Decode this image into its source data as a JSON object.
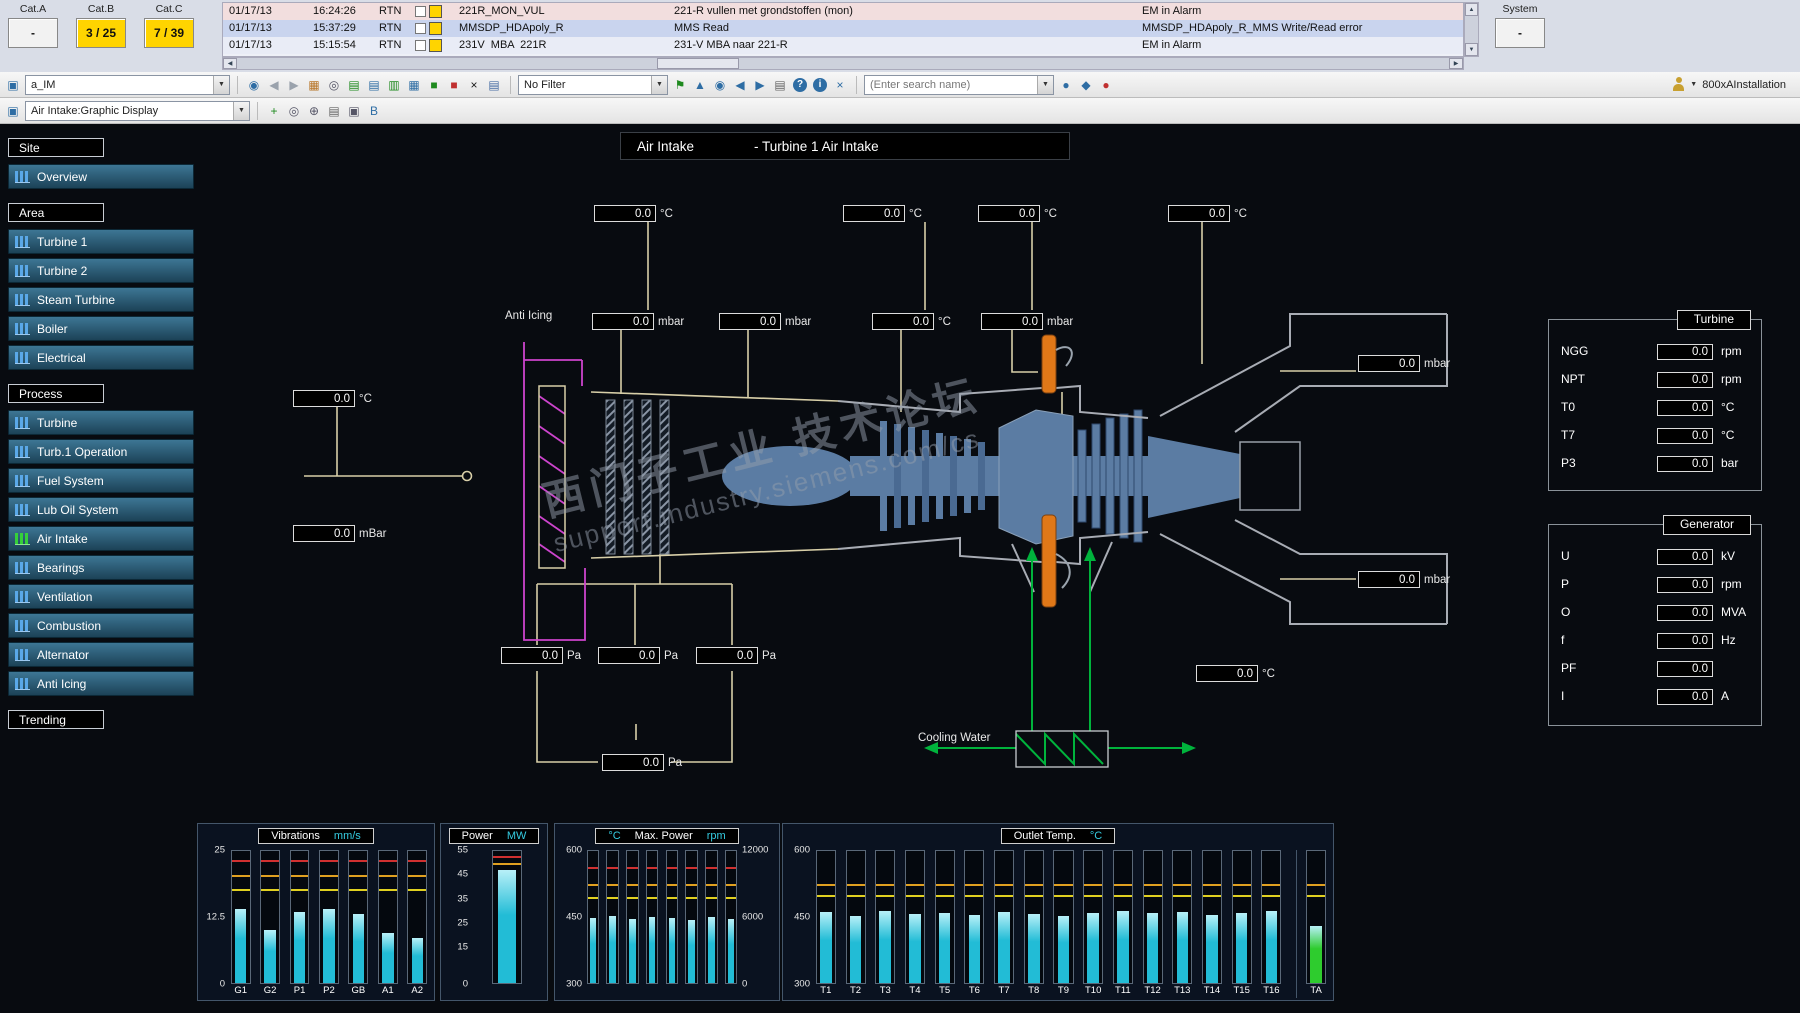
{
  "alarm_bar": {
    "categories": [
      {
        "label": "Cat.A",
        "value": "-",
        "alarm": false
      },
      {
        "label": "Cat.B",
        "value": "3 / 25",
        "alarm": true
      },
      {
        "label": "Cat.C",
        "value": "7 / 39",
        "alarm": true
      }
    ],
    "rows": [
      {
        "date": "01/17/13",
        "time": "16:24:26",
        "type": "RTN",
        "tag": "221R_MON_VUL",
        "description": "221-R vullen met grondstoffen (mon)",
        "status": "EM in Alarm"
      },
      {
        "date": "01/17/13",
        "time": "15:37:29",
        "type": "RTN",
        "tag": "MMSDP_HDApoly_R",
        "description": "MMS Read",
        "status": "MMSDP_HDApoly_R_MMS Write/Read error"
      },
      {
        "date": "01/17/13",
        "time": "15:15:54",
        "type": "RTN",
        "tag": "231V  MBA  221R",
        "description": "231-V MBA naar 221-R",
        "status": "EM in Alarm"
      }
    ],
    "system": {
      "label": "System",
      "value": "-"
    }
  },
  "toolbar": {
    "left_icons": [
      "display-select-icon"
    ],
    "app_select": "a_IM",
    "mid_icons": [
      "save-aspect-icon",
      "back-icon",
      "forward-icon",
      "layout-icon",
      "zoom-icon",
      "alarm-list-icon",
      "event-list-icon",
      "trend-display-icon",
      "table-icon",
      "graphic-ok-icon",
      "graphic-stop-icon",
      "cut-icon",
      "document-icon"
    ],
    "filter_select": "No Filter",
    "nav_icons": [
      "filter-flag-icon",
      "up-level-icon",
      "target-icon",
      "browse-back-icon",
      "browse-forward-icon",
      "print-icon",
      "help-icon",
      "info-icon",
      "close-search-icon"
    ],
    "search_placeholder": "(Enter search name)",
    "right_icons": [
      "operator-icon",
      "find-user-icon",
      "security-stop-icon"
    ],
    "user_label": "800xAInstallation"
  },
  "toolbar2": {
    "left_icons": [
      "display-select-icon"
    ],
    "view_select": "Air Intake:Graphic Display",
    "right_icons": [
      "add-icon",
      "zoom-icon",
      "pan-hand-icon",
      "print-icon",
      "snapshot-icon",
      "bold-icon"
    ]
  },
  "sidebar": {
    "sections": [
      {
        "header": "Site",
        "items": [
          {
            "label": "Overview"
          }
        ]
      },
      {
        "header": "Area",
        "items": [
          {
            "label": "Turbine 1"
          },
          {
            "label": "Turbine 2"
          },
          {
            "label": "Steam Turbine"
          },
          {
            "label": "Boiler"
          },
          {
            "label": "Electrical"
          }
        ]
      },
      {
        "header": "Process",
        "items": [
          {
            "label": "Turbine"
          },
          {
            "label": "Turb.1 Operation"
          },
          {
            "label": "Fuel System"
          },
          {
            "label": "Lub Oil System"
          },
          {
            "label": "Air Intake",
            "active": true
          },
          {
            "label": "Bearings"
          },
          {
            "label": "Ventilation"
          },
          {
            "label": "Combustion"
          },
          {
            "label": "Alternator"
          },
          {
            "label": "Anti Icing"
          }
        ]
      },
      {
        "header": "Trending",
        "items": []
      }
    ]
  },
  "display": {
    "title_left": "Air Intake",
    "title_right": "- Turbine 1 Air Intake",
    "labels": {
      "anti_icing": "Anti Icing",
      "cooling_water": "Cooling Water"
    },
    "watermark": {
      "line1": "西门子工业 技术论坛",
      "line2": "support.industry.siemens.com/cs"
    },
    "measurements": [
      {
        "value": "0.0",
        "unit": "°C"
      },
      {
        "value": "0.0",
        "unit": "°C"
      },
      {
        "value": "0.0",
        "unit": "°C"
      },
      {
        "value": "0.0",
        "unit": "°C"
      },
      {
        "value": "0.0",
        "unit": "mbar"
      },
      {
        "value": "0.0",
        "unit": "mbar"
      },
      {
        "value": "0.0",
        "unit": "°C"
      },
      {
        "value": "0.0",
        "unit": "mbar"
      },
      {
        "value": "0.0",
        "unit": "mbar"
      },
      {
        "value": "0.0",
        "unit": "mbar"
      },
      {
        "value": "0.0",
        "unit": "°C"
      },
      {
        "value": "0.0",
        "unit": "mBar"
      },
      {
        "value": "0.0",
        "unit": "Pa"
      },
      {
        "value": "0.0",
        "unit": "Pa"
      },
      {
        "value": "0.0",
        "unit": "Pa"
      },
      {
        "value": "0.0",
        "unit": "Pa"
      },
      {
        "value": "0.0",
        "unit": "°C"
      }
    ],
    "value_panels": [
      {
        "title": "Turbine",
        "rows": [
          {
            "label": "NGG",
            "value": "0.0",
            "unit": "rpm"
          },
          {
            "label": "NPT",
            "value": "0.0",
            "unit": "rpm"
          },
          {
            "label": "T0",
            "value": "0.0",
            "unit": "°C"
          },
          {
            "label": "T7",
            "value": "0.0",
            "unit": "°C"
          },
          {
            "label": "P3",
            "value": "0.0",
            "unit": "bar"
          }
        ]
      },
      {
        "title": "Generator",
        "rows": [
          {
            "label": "U",
            "value": "0.0",
            "unit": "kV"
          },
          {
            "label": "P",
            "value": "0.0",
            "unit": "rpm"
          },
          {
            "label": "O",
            "value": "0.0",
            "unit": "MVA"
          },
          {
            "label": "f",
            "value": "0.0",
            "unit": "Hz"
          },
          {
            "label": "PF",
            "value": "0.0",
            "unit": ""
          },
          {
            "label": "I",
            "value": "0.0",
            "unit": "A"
          }
        ]
      }
    ]
  },
  "colors": {
    "bar_cyan": "#22bcd6",
    "bar_green": "#2ecc2e",
    "unit_cyan": "#35cbe0",
    "alarm_yellow": "#ffd400"
  },
  "chart_data": [
    {
      "type": "bar",
      "title": "Vibrations",
      "value_unit": "mm/s",
      "categories": [
        "G1",
        "G2",
        "P1",
        "P2",
        "GB",
        "A1",
        "A2"
      ],
      "values": [
        14,
        10,
        13.5,
        14,
        13,
        9.5,
        8.5
      ],
      "ylim": [
        0,
        25
      ],
      "yticks": [
        25,
        12.5,
        0
      ],
      "limits": [
        {
          "value": 23,
          "color": "#d03030"
        },
        {
          "value": 20,
          "color": "#e0a020"
        },
        {
          "value": 17.5,
          "color": "#e0d020"
        }
      ]
    },
    {
      "type": "bar",
      "title": "Power",
      "value_unit": "MW",
      "categories": [
        ""
      ],
      "values": [
        47
      ],
      "ylim": [
        0,
        55
      ],
      "yticks": [
        55,
        45,
        35,
        25,
        15,
        0
      ],
      "limits": [
        {
          "value": 52,
          "color": "#d03030"
        },
        {
          "value": 49,
          "color": "#e0a020"
        }
      ]
    },
    {
      "type": "bar",
      "title": "Max. Power",
      "left_unit": "°C",
      "value_unit": "rpm",
      "categories": [
        "",
        "",
        "",
        "",
        "",
        "",
        "",
        ""
      ],
      "values": [
        448,
        452,
        446,
        450,
        448,
        444,
        450,
        446
      ],
      "ylim": [
        300,
        600
      ],
      "yticks": [
        600,
        450,
        300
      ],
      "right_ylim": [
        0,
        12000
      ],
      "right_yticks": [
        12000,
        6000,
        0
      ],
      "limits": [
        {
          "value": 560,
          "color": "#d03030"
        },
        {
          "value": 520,
          "color": "#e0a020"
        },
        {
          "value": 490,
          "color": "#e0d020"
        }
      ]
    },
    {
      "type": "bar",
      "title": "Outlet Temp.",
      "value_unit": "°C",
      "categories": [
        "T1",
        "T2",
        "T3",
        "T4",
        "T5",
        "T6",
        "T7",
        "T8",
        "T9",
        "T10",
        "T11",
        "T12",
        "T13",
        "T14",
        "T15",
        "T16",
        "TA"
      ],
      "values": [
        462,
        452,
        464,
        456,
        460,
        454,
        462,
        456,
        452,
        460,
        464,
        458,
        462,
        454,
        460,
        464,
        430
      ],
      "ylim": [
        300,
        600
      ],
      "yticks": [
        600,
        450,
        300
      ],
      "separated_last": true,
      "last_color": "#2ecc2e",
      "limits": [
        {
          "value": 520,
          "color": "#e0a020"
        },
        {
          "value": 495,
          "color": "#e0d020"
        }
      ]
    }
  ]
}
